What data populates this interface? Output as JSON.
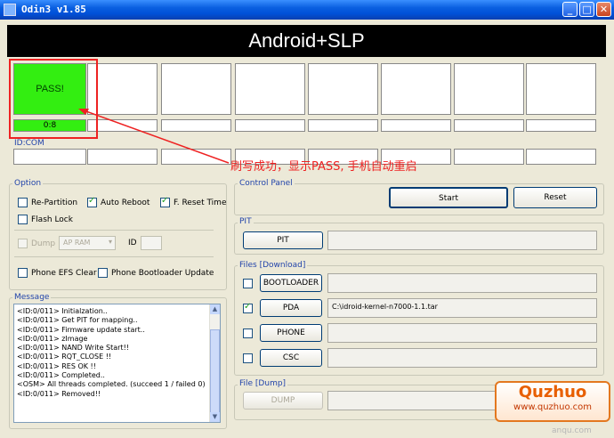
{
  "window": {
    "title": "Odin3 v1.85",
    "minimize": "_",
    "maximize": "□",
    "close": "✕"
  },
  "banner": {
    "text": "Android+SLP"
  },
  "slots": [
    {
      "status": "PASS!",
      "progress": "0:8"
    },
    {
      "status": "",
      "progress": ""
    },
    {
      "status": "",
      "progress": ""
    },
    {
      "status": "",
      "progress": ""
    },
    {
      "status": "",
      "progress": ""
    },
    {
      "status": "",
      "progress": ""
    },
    {
      "status": "",
      "progress": ""
    },
    {
      "status": "",
      "progress": ""
    }
  ],
  "idcom": {
    "label": "ID:COM"
  },
  "annotation": {
    "text": "刷写成功，显示PASS, 手机自动重启"
  },
  "option": {
    "label": "Option",
    "re_partition": "Re-Partition",
    "auto_reboot": "Auto Reboot",
    "f_reset_time": "F. Reset Time",
    "flash_lock": "Flash Lock",
    "dump": "Dump",
    "dump_select": "AP RAM",
    "id": "ID",
    "phone_efs_clear": "Phone EFS Clear",
    "phone_bootloader_update": "Phone Bootloader Update"
  },
  "message": {
    "label": "Message",
    "lines": "<ID:0/011> Initialzation..\n<ID:0/011> Get PIT for mapping..\n<ID:0/011> Firmware update start..\n<ID:0/011> zImage\n<ID:0/011> NAND Write Start!!\n<ID:0/011> RQT_CLOSE !!\n<ID:0/011> RES OK !!\n<ID:0/011> Completed..\n<OSM> All threads completed. (succeed 1 / failed 0)\n<ID:0/011> Removed!!"
  },
  "control": {
    "label": "Control Panel",
    "start": "Start",
    "reset": "Reset"
  },
  "pit": {
    "label": "PIT",
    "button": "PIT"
  },
  "files": {
    "label": "Files [Download]",
    "bootloader": "BOOTLOADER",
    "pda": "PDA",
    "pda_path": "C:\\idroid-kernel-n7000-1.1.tar",
    "phone": "PHONE",
    "csc": "CSC"
  },
  "dumpfile": {
    "label": "File [Dump]",
    "button": "DUMP"
  },
  "watermark": {
    "brand": "Quzhuo",
    "url": "www.quzhuo.com",
    "sub": "anqu.com"
  },
  "colors": {
    "pass": "#33ee11",
    "annotation": "#ee2222",
    "titlebar": "#0a5fe0"
  }
}
